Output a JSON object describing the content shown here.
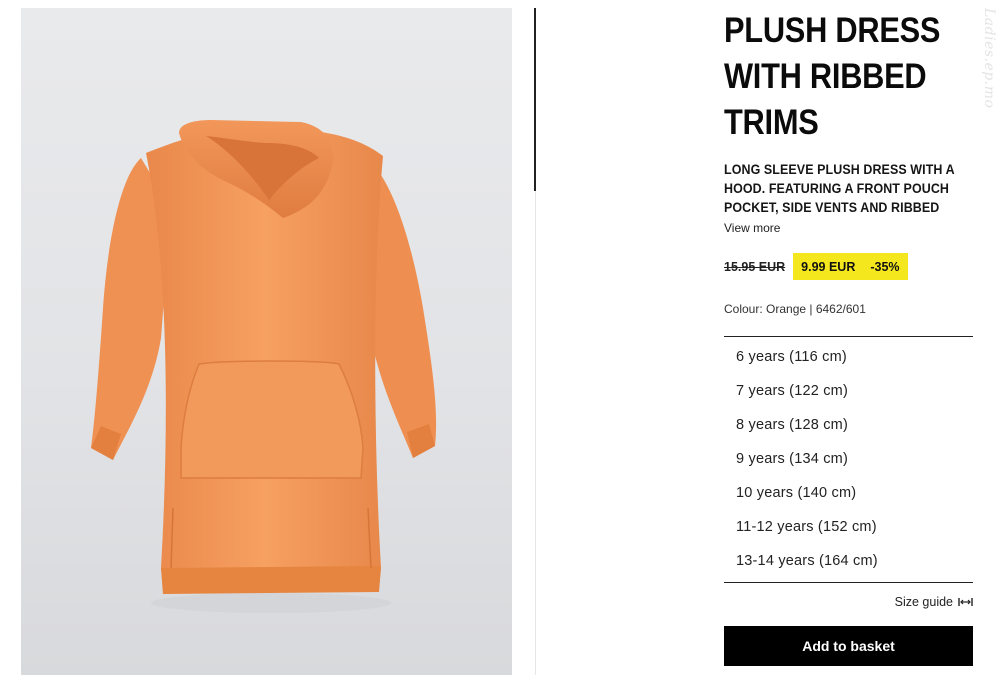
{
  "product": {
    "title_lines": [
      "PLUSH DRESS",
      "WITH RIBBED",
      "TRIMS"
    ],
    "description": "LONG SLEEVE PLUSH DRESS WITH A HOOD. FEATURING A FRONT POUCH POCKET, SIDE VENTS AND RIBBED",
    "view_more_label": "View more",
    "old_price": "15.95 EUR",
    "sale_price": "9.99 EUR",
    "discount": "-35%",
    "colour_label": "Colour: Orange | 6462/601",
    "sizes": [
      "6 years (116 cm)",
      "7 years (122 cm)",
      "8 years (128 cm)",
      "9 years (134 cm)",
      "10 years (140 cm)",
      "11-12 years (152 cm)",
      "13-14 years (164 cm)"
    ],
    "size_guide_label": "Size guide",
    "add_to_basket_label": "Add to basket"
  },
  "watermark": "Ladies.ep.mo",
  "icons": {
    "size_guide": "ruler-arrows-icon",
    "product_image": "orange-hoodie-dress-image"
  },
  "colors": {
    "sale_highlight": "#f5e71d",
    "button_bg": "#000000",
    "product_orange": "#f39a55"
  }
}
